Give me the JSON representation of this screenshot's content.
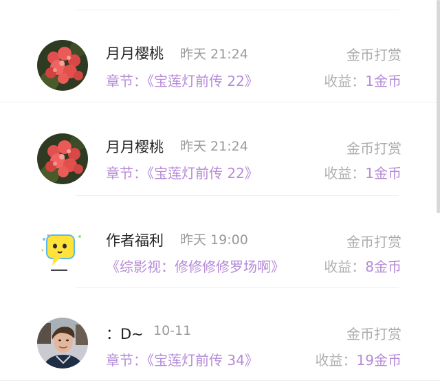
{
  "items": [
    {
      "name": "月月樱桃",
      "time": "昨天 21:24",
      "chapter": "章节：《宝莲灯前传 22》",
      "type": "金币打赏",
      "income_label": "收益：",
      "income_value": "1金币",
      "avatar": "red-flower-avatar"
    },
    {
      "name": "月月樱桃",
      "time": "昨天 21:24",
      "chapter": "章节：《宝莲灯前传 22》",
      "type": "金币打赏",
      "income_label": "收益：",
      "income_value": "1金币",
      "avatar": "red-flower-avatar"
    },
    {
      "name": "作者福利",
      "time": "昨天 19:00",
      "chapter": "《综影视：修修修修罗场啊》",
      "type": "金币打赏",
      "income_label": "收益：",
      "income_value": "8金币",
      "avatar": "yellow-speech-bubble-avatar"
    },
    {
      "name": "：D~",
      "time": "10-11",
      "chapter": "章节：《宝莲灯前传 34》",
      "type": "金币打赏",
      "income_label": "收益：",
      "income_value": "19金币",
      "avatar": "person-photo-avatar"
    }
  ],
  "colors": {
    "accent": "#b58ad8",
    "name": "#222222",
    "muted": "#999999"
  }
}
